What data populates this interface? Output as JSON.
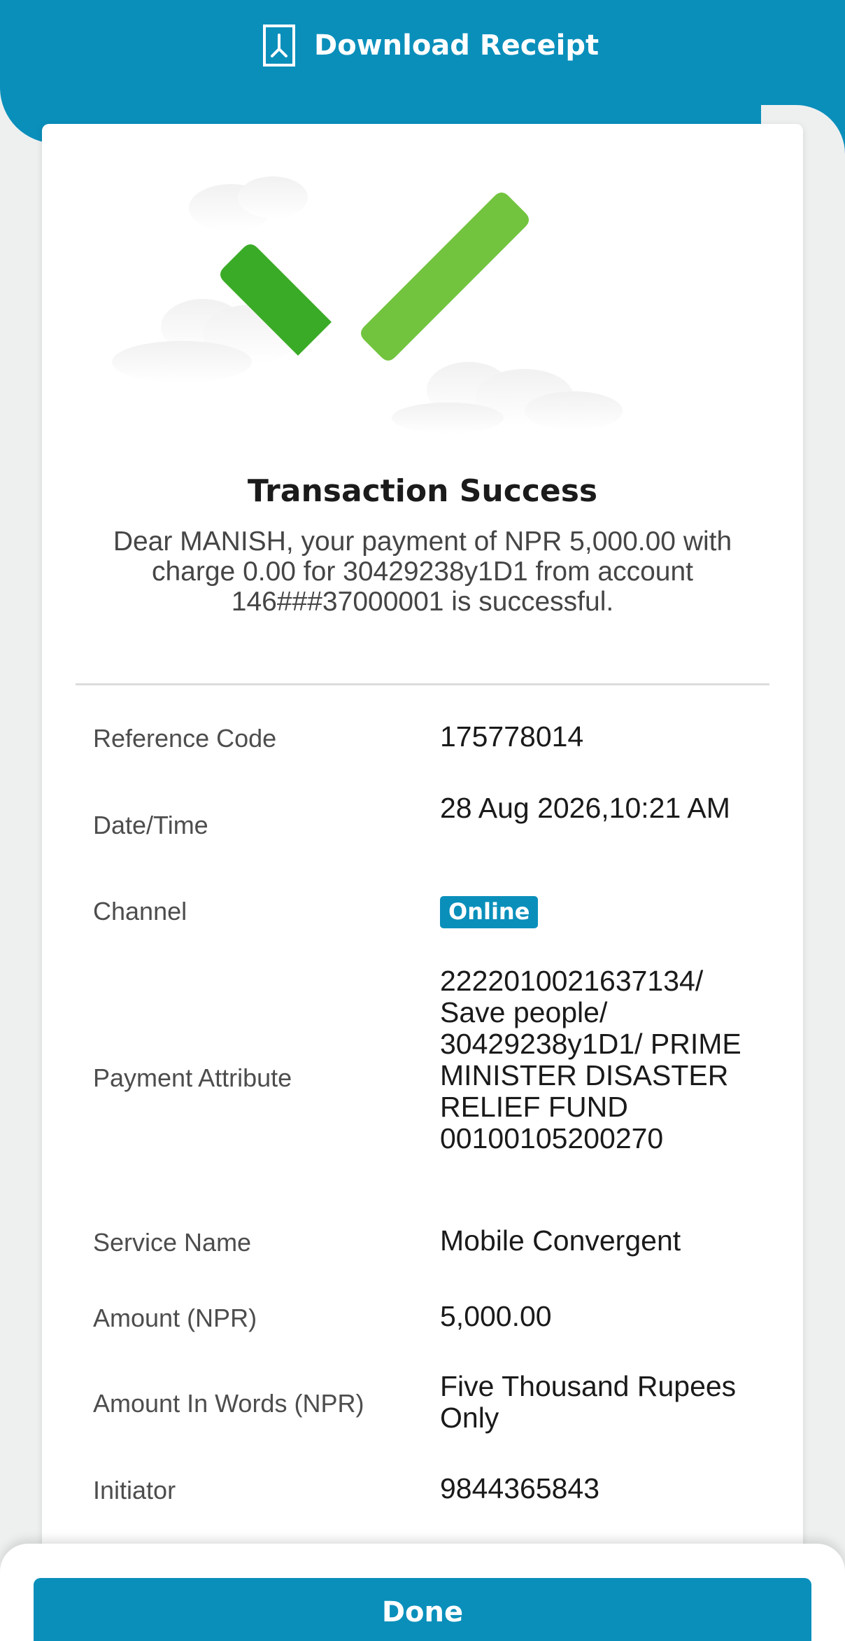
{
  "header": {
    "download_label": "Download Receipt",
    "icon": "pdf-document-icon"
  },
  "status": {
    "icon": "checkmark-success-icon",
    "title": "Transaction Success",
    "message": "Dear MANISH, your payment of NPR 5,000.00 with charge 0.00 for 30429238y1D1 from account 146###37000001 is successful."
  },
  "details": [
    {
      "label": "Reference Code",
      "value": "175778014"
    },
    {
      "label": "Date/Time",
      "value": "28 Aug 2026,10:21 AM"
    },
    {
      "label": "Channel",
      "value": "Online"
    },
    {
      "label": "Payment Attribute",
      "value": "2222010021637134/ Save people/ 30429238y1D1/ PRIME MINISTER DISASTER RELIEF FUND 00100105200270"
    },
    {
      "label": "Service Name",
      "value": "Mobile Convergent"
    },
    {
      "label": "Amount (NPR)",
      "value": "5,000.00"
    },
    {
      "label": "Amount In Words (NPR)",
      "value": "Five Thousand Rupees Only"
    },
    {
      "label": "Initiator",
      "value": "9844365843"
    }
  ],
  "footer": {
    "done_label": "Done"
  },
  "colors": {
    "primary": "#0a8fbb",
    "success_dark": "#3aab26",
    "success_light": "#72c43e",
    "background": "#eef0f0"
  }
}
